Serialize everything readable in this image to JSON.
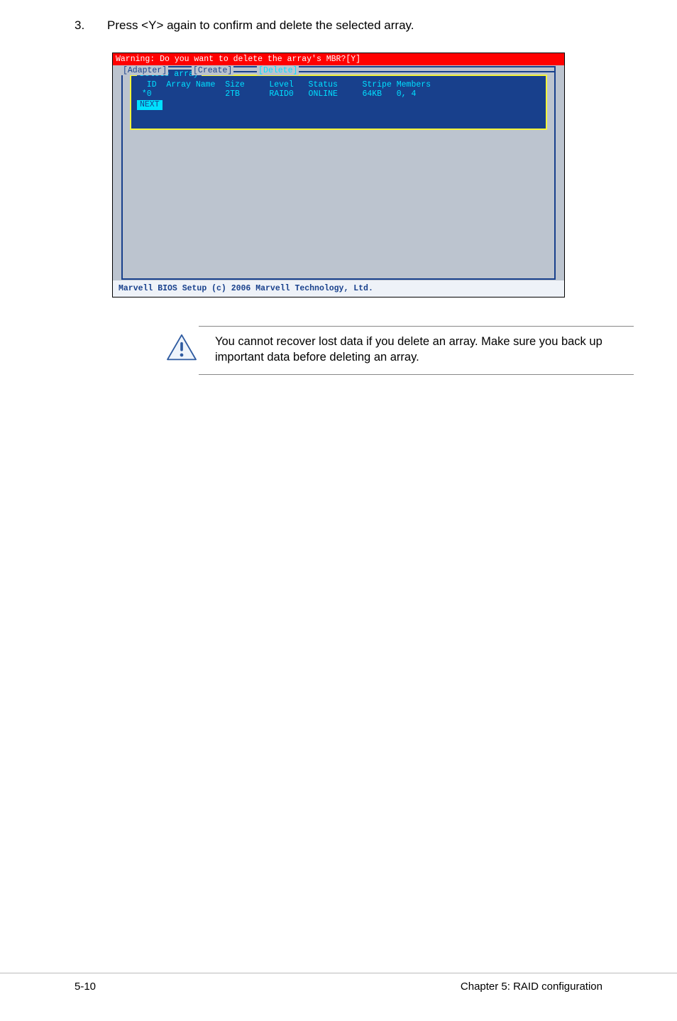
{
  "step": {
    "number": "3.",
    "text": "Press <Y> again to confirm and delete the selected array."
  },
  "bios": {
    "warning": "Warning: Do you want to delete the array's MBR?[Y]",
    "tabs": {
      "adapter": "[Adapter]",
      "create": "[Create]",
      "del": "[Delete]"
    },
    "panel": {
      "title": "Delete array",
      "header": "  ID  Array Name  Size     Level   Status     Stripe Members",
      "row": " *0               2TB      RAID0   ONLINE     64KB   0, 4",
      "next": "NEXT"
    },
    "footer": "Marvell BIOS Setup (c) 2006 Marvell Technology, Ltd."
  },
  "note": {
    "text": "You cannot recover lost data if you delete an array. Make sure you back up important data before deleting an array."
  },
  "pageFooter": {
    "left": "5-10",
    "right": "Chapter 5: RAID configuration"
  }
}
